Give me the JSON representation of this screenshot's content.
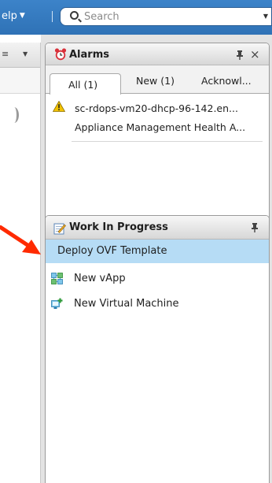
{
  "topbar": {
    "help_label": "elp",
    "search": {
      "placeholder": "Search"
    }
  },
  "alarms": {
    "title": "Alarms",
    "tabs": [
      {
        "label": "All (1)",
        "selected": true
      },
      {
        "label": "New (1)",
        "selected": false
      },
      {
        "label": "Acknowl...",
        "selected": false
      }
    ],
    "items": [
      {
        "icon": "warning-icon",
        "line1": "sc-rdops-vm20-dhcp-96-142.en...",
        "line2": "Appliance Management Health A..."
      }
    ]
  },
  "work_in_progress": {
    "title": "Work In Progress",
    "items": [
      {
        "label": "Deploy OVF Template",
        "icon": "",
        "selected": true
      },
      {
        "label": "New vApp",
        "icon": "vapp-icon",
        "selected": false
      },
      {
        "label": "New Virtual Machine",
        "icon": "virtual-machine-icon",
        "selected": false
      }
    ]
  },
  "colors": {
    "topbar": "#2f72b6",
    "selection": "#b6dcf5",
    "warning": "#f2c200",
    "annotation_arrow": "#ff2a00"
  }
}
